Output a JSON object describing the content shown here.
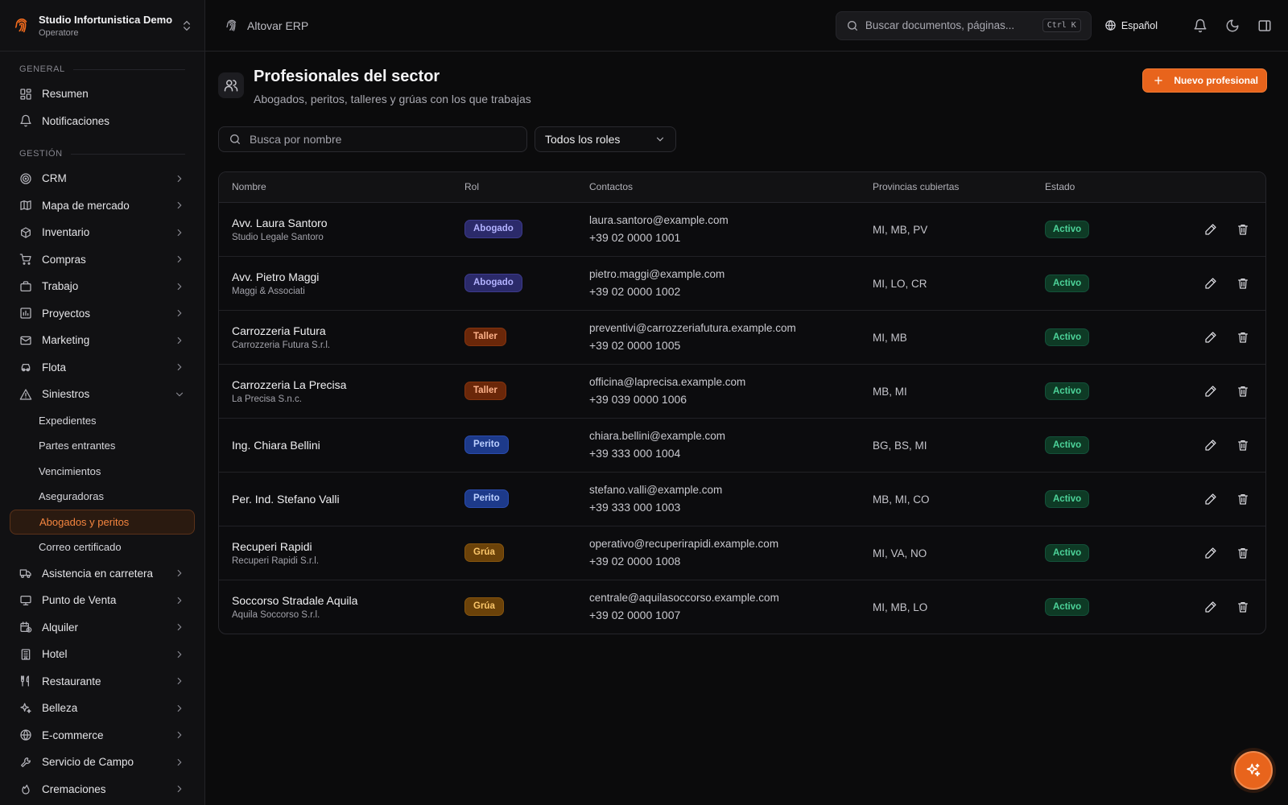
{
  "org": {
    "name": "Studio Infortunistica Demo",
    "role": "Operatore"
  },
  "nav": {
    "general_label": "GENERAL",
    "general_items": [
      {
        "label": "Resumen",
        "icon": "dashboard-icon"
      },
      {
        "label": "Notificaciones",
        "icon": "bell-icon"
      }
    ],
    "gestion_label": "GESTIÓN",
    "gestion_items": [
      {
        "label": "CRM",
        "icon": "target-icon"
      },
      {
        "label": "Mapa de mercado",
        "icon": "map-icon"
      },
      {
        "label": "Inventario",
        "icon": "package-icon"
      },
      {
        "label": "Compras",
        "icon": "cart-icon"
      },
      {
        "label": "Trabajo",
        "icon": "briefcase-icon"
      },
      {
        "label": "Proyectos",
        "icon": "chart-icon"
      },
      {
        "label": "Marketing",
        "icon": "mail-icon"
      },
      {
        "label": "Flota",
        "icon": "car-icon"
      },
      {
        "label": "Siniestros",
        "icon": "warning-icon"
      }
    ],
    "siniestros_sub": [
      "Expedientes",
      "Partes entrantes",
      "Vencimientos",
      "Aseguradoras",
      "Abogados y peritos",
      "Correo certificado"
    ],
    "more_items": [
      {
        "label": "Asistencia en carretera",
        "icon": "truck-icon"
      },
      {
        "label": "Punto de Venta",
        "icon": "monitor-icon"
      },
      {
        "label": "Alquiler",
        "icon": "calendar-clock-icon"
      },
      {
        "label": "Hotel",
        "icon": "building-icon"
      },
      {
        "label": "Restaurante",
        "icon": "utensils-icon"
      },
      {
        "label": "Belleza",
        "icon": "sparkles-icon"
      },
      {
        "label": "E-commerce",
        "icon": "globe-icon"
      },
      {
        "label": "Servicio de Campo",
        "icon": "wrench-icon"
      },
      {
        "label": "Cremaciones",
        "icon": "flame-icon"
      }
    ]
  },
  "topbar": {
    "brand": "Altovar ERP",
    "search_placeholder": "Buscar documentos, páginas...",
    "shortcut": "Ctrl K",
    "language": "Español"
  },
  "page": {
    "title": "Profesionales del sector",
    "subtitle": "Abogados, peritos, talleres y grúas con los que trabajas",
    "new_button": "Nuevo profesional",
    "search_placeholder": "Busca por nombre",
    "role_filter": "Todos los roles"
  },
  "table": {
    "headers": [
      "Nombre",
      "Rol",
      "Contactos",
      "Provincias cubiertas",
      "Estado"
    ],
    "rows": [
      {
        "name": "Avv. Laura Santoro",
        "company": "Studio Legale Santoro",
        "role": "Abogado",
        "role_type": "abogado",
        "email": "laura.santoro@example.com",
        "phone": "+39 02 0000 1001",
        "provinces": "MI, MB, PV",
        "status": "Activo"
      },
      {
        "name": "Avv. Pietro Maggi",
        "company": "Maggi & Associati",
        "role": "Abogado",
        "role_type": "abogado",
        "email": "pietro.maggi@example.com",
        "phone": "+39 02 0000 1002",
        "provinces": "MI, LO, CR",
        "status": "Activo"
      },
      {
        "name": "Carrozzeria Futura",
        "company": "Carrozzeria Futura S.r.l.",
        "role": "Taller",
        "role_type": "taller",
        "email": "preventivi@carrozzeriafutura.example.com",
        "phone": "+39 02 0000 1005",
        "provinces": "MI, MB",
        "status": "Activo"
      },
      {
        "name": "Carrozzeria La Precisa",
        "company": "La Precisa S.n.c.",
        "role": "Taller",
        "role_type": "taller",
        "email": "officina@laprecisa.example.com",
        "phone": "+39 039 0000 1006",
        "provinces": "MB, MI",
        "status": "Activo"
      },
      {
        "name": "Ing. Chiara Bellini",
        "company": "",
        "role": "Perito",
        "role_type": "perito",
        "email": "chiara.bellini@example.com",
        "phone": "+39 333 000 1004",
        "provinces": "BG, BS, MI",
        "status": "Activo"
      },
      {
        "name": "Per. Ind. Stefano Valli",
        "company": "",
        "role": "Perito",
        "role_type": "perito",
        "email": "stefano.valli@example.com",
        "phone": "+39 333 000 1003",
        "provinces": "MB, MI, CO",
        "status": "Activo"
      },
      {
        "name": "Recuperi Rapidi",
        "company": "Recuperi Rapidi S.r.l.",
        "role": "Grúa",
        "role_type": "grua",
        "email": "operativo@recuperirapidi.example.com",
        "phone": "+39 02 0000 1008",
        "provinces": "MI, VA, NO",
        "status": "Activo"
      },
      {
        "name": "Soccorso Stradale Aquila",
        "company": "Aquila Soccorso S.r.l.",
        "role": "Grúa",
        "role_type": "grua",
        "email": "centrale@aquilasoccorso.example.com",
        "phone": "+39 02 0000 1007",
        "provinces": "MI, MB, LO",
        "status": "Activo"
      }
    ]
  },
  "colors": {
    "accent": "#e8641c",
    "background": "#0b0b0c",
    "sidebar": "#111113",
    "status_active": "#4dd49a"
  }
}
